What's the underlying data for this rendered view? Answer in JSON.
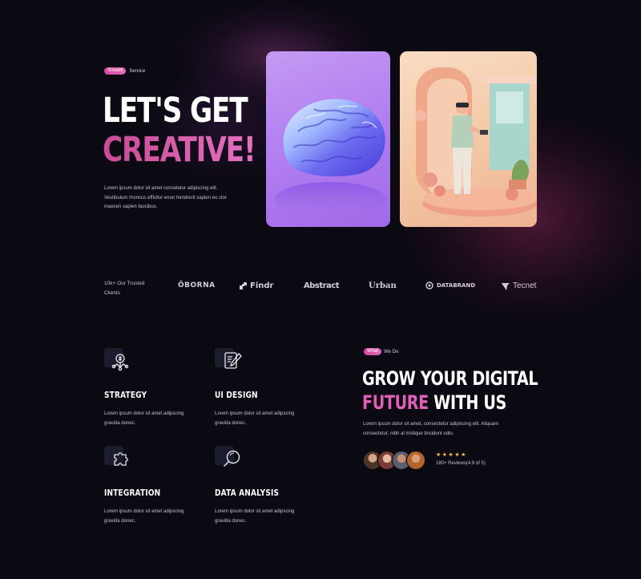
{
  "hero": {
    "tag_pill": "Stream",
    "tag_text": "Service",
    "title_line1": "LET'S GET",
    "title_line2": "CREATIVE!",
    "description": "Lorem ipsum dolor sit amet consetetur adipiscing elit. Vestibulum rhoncus efficitur enon hendrerit sapien eu ctor maecen sapien faucibus."
  },
  "clients": {
    "label": "10k+ Our Trusted Clients",
    "logos": [
      {
        "name": "ÖBORNA",
        "icon": ""
      },
      {
        "name": "Findr",
        "icon": "findr-mark-icon"
      },
      {
        "name": "Abstract",
        "icon": ""
      },
      {
        "name": "Urban",
        "icon": ""
      },
      {
        "name": "DATABRAND",
        "icon": "databrand-mark-icon"
      },
      {
        "name": "Tecnet",
        "icon": "tecnet-mark-icon"
      }
    ]
  },
  "services": [
    {
      "title": "STRATEGY",
      "desc": "Lorem ipsum dolor sit amet adipscing gravida donec.",
      "icon": "strategy-icon"
    },
    {
      "title": "UI DESIGN",
      "desc": "Lorem ipsum dolor sit amet adipscing gravida donec.",
      "icon": "ui-design-icon"
    },
    {
      "title": "INTEGRATION",
      "desc": "Lorem ipsum dolor sit amet adipscing gravida donec.",
      "icon": "puzzle-icon"
    },
    {
      "title": "DATA ANALYSIS",
      "desc": "Lorem ipsum dolor sit amet adipscing gravida donec.",
      "icon": "magnifier-icon"
    }
  ],
  "what_we_do": {
    "tag_pill": "What",
    "tag_text": "We Do",
    "title_line1": "GROW YOUR DIGITAL",
    "title_pink": "FUTURE",
    "title_rest": " WITH US",
    "description": "Lorem ipsum dolor sit amet, consectetur adipiscing elit. Aliquam consectetur, nibh at tristique tincidunt odio.",
    "stars": "★★★★★",
    "reviews": "180+ Reviews(4.9 of 5)"
  },
  "colors": {
    "background": "#0b0912",
    "accent_pink": "#e060b8",
    "pill_gradient_start": "#d9469c",
    "star": "#f5c044"
  }
}
